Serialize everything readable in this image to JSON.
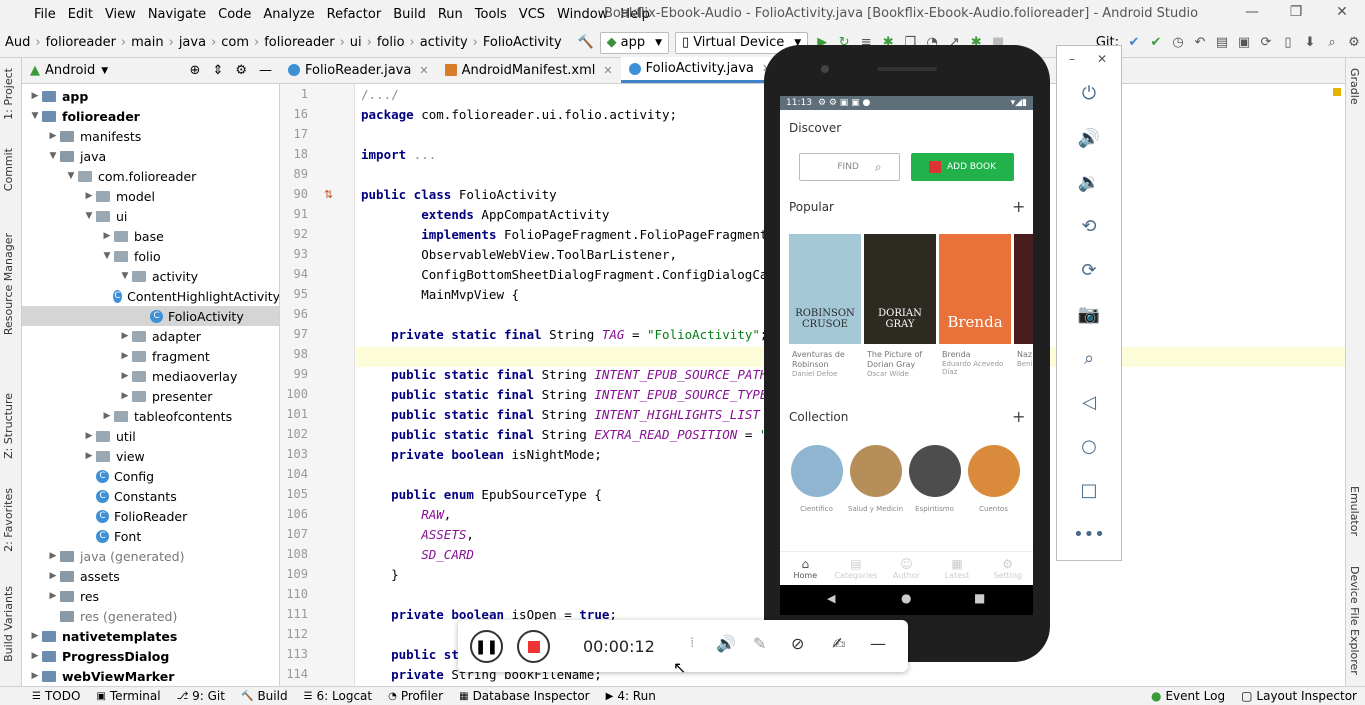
{
  "window": {
    "title": "Bookflix-Ebook-Audio - FolioActivity.java [Bookflix-Ebook-Audio.folioreader] - Android Studio",
    "menus": [
      "File",
      "Edit",
      "View",
      "Navigate",
      "Code",
      "Analyze",
      "Refactor",
      "Build",
      "Run",
      "Tools",
      "VCS",
      "Window",
      "Help"
    ]
  },
  "toolbar": {
    "breadcrumbs": [
      "Aud",
      "folioreader",
      "main",
      "java",
      "com",
      "folioreader",
      "ui",
      "folio",
      "activity",
      "FolioActivity"
    ],
    "run_config": "app",
    "device": "Virtual Device",
    "git_label": "Git:"
  },
  "left_strip": {
    "tabs": [
      "1: Project",
      "Commit",
      "Resource Manager",
      "Z: Structure",
      "2: Favorites",
      "Build Variants"
    ]
  },
  "right_strip": {
    "tabs": [
      "Gradle",
      "Emulator",
      "Device File Explorer"
    ]
  },
  "project": {
    "view_label": "Android",
    "tree": [
      {
        "label": "app",
        "depth": 0,
        "arrow": "▶",
        "icon": "mod",
        "bold": true
      },
      {
        "label": "folioreader",
        "depth": 0,
        "arrow": "▼",
        "icon": "mod",
        "bold": true
      },
      {
        "label": "manifests",
        "depth": 1,
        "arrow": "▶",
        "icon": "folder"
      },
      {
        "label": "java",
        "depth": 1,
        "arrow": "▼",
        "icon": "folder"
      },
      {
        "label": "com.folioreader",
        "depth": 2,
        "arrow": "▼",
        "icon": "pkg"
      },
      {
        "label": "model",
        "depth": 3,
        "arrow": "▶",
        "icon": "pkg"
      },
      {
        "label": "ui",
        "depth": 3,
        "arrow": "▼",
        "icon": "pkg"
      },
      {
        "label": "base",
        "depth": 4,
        "arrow": "▶",
        "icon": "pkg"
      },
      {
        "label": "folio",
        "depth": 4,
        "arrow": "▼",
        "icon": "pkg"
      },
      {
        "label": "activity",
        "depth": 5,
        "arrow": "▼",
        "icon": "pkg"
      },
      {
        "label": "ContentHighlightActivity",
        "depth": 6,
        "arrow": "",
        "icon": "cls"
      },
      {
        "label": "FolioActivity",
        "depth": 6,
        "arrow": "",
        "icon": "cls",
        "selected": true
      },
      {
        "label": "adapter",
        "depth": 5,
        "arrow": "▶",
        "icon": "pkg"
      },
      {
        "label": "fragment",
        "depth": 5,
        "arrow": "▶",
        "icon": "pkg"
      },
      {
        "label": "mediaoverlay",
        "depth": 5,
        "arrow": "▶",
        "icon": "pkg"
      },
      {
        "label": "presenter",
        "depth": 5,
        "arrow": "▶",
        "icon": "pkg"
      },
      {
        "label": "tableofcontents",
        "depth": 4,
        "arrow": "▶",
        "icon": "pkg"
      },
      {
        "label": "util",
        "depth": 3,
        "arrow": "▶",
        "icon": "pkg"
      },
      {
        "label": "view",
        "depth": 3,
        "arrow": "▶",
        "icon": "pkg"
      },
      {
        "label": "Config",
        "depth": 3,
        "arrow": "",
        "icon": "cls"
      },
      {
        "label": "Constants",
        "depth": 3,
        "arrow": "",
        "icon": "cls"
      },
      {
        "label": "FolioReader",
        "depth": 3,
        "arrow": "",
        "icon": "cls"
      },
      {
        "label": "Font",
        "depth": 3,
        "arrow": "",
        "icon": "cls"
      },
      {
        "label": "java (generated)",
        "depth": 1,
        "arrow": "▶",
        "icon": "folder"
      },
      {
        "label": "assets",
        "depth": 1,
        "arrow": "▶",
        "icon": "folder"
      },
      {
        "label": "res",
        "depth": 1,
        "arrow": "▶",
        "icon": "folder"
      },
      {
        "label": "res (generated)",
        "depth": 1,
        "arrow": "",
        "icon": "folder"
      },
      {
        "label": "nativetemplates",
        "depth": 0,
        "arrow": "▶",
        "icon": "mod",
        "bold": true
      },
      {
        "label": "ProgressDialog",
        "depth": 0,
        "arrow": "▶",
        "icon": "mod",
        "bold": true
      },
      {
        "label": "webViewMarker",
        "depth": 0,
        "arrow": "▶",
        "icon": "mod",
        "bold": true
      }
    ]
  },
  "editor": {
    "tabs": [
      {
        "label": "FolioReader.java",
        "active": false
      },
      {
        "label": "AndroidManifest.xml",
        "active": false
      },
      {
        "label": "FolioActivity.java",
        "active": true
      }
    ],
    "lines": [
      {
        "n": "1",
        "html": "<span class=\"cm\">/.../</span>"
      },
      {
        "n": "16",
        "html": "<span class=\"kw\">package</span> com.folioreader.ui.folio.activity;"
      },
      {
        "n": "17",
        "html": ""
      },
      {
        "n": "18",
        "html": "<span class=\"kw\">import</span> <span class=\"cm\">...</span>"
      },
      {
        "n": "89",
        "html": ""
      },
      {
        "n": "90",
        "html": "<span class=\"kw\">public class</span> FolioActivity"
      },
      {
        "n": "91",
        "html": "        <span class=\"kw\">extends</span> AppCompatActivity"
      },
      {
        "n": "92",
        "html": "        <span class=\"kw\">implements</span> FolioPageFragment.FolioPageFragmentCallback,"
      },
      {
        "n": "93",
        "html": "        ObservableWebView.ToolBarListener,"
      },
      {
        "n": "94",
        "html": "        ConfigBottomSheetDialogFragment.ConfigDialogCallback,"
      },
      {
        "n": "95",
        "html": "        MainMvpView {"
      },
      {
        "n": "96",
        "html": ""
      },
      {
        "n": "97",
        "html": "    <span class=\"kw\">private static final</span> String <span class=\"it\">TAG</span> = <span class=\"str\">\"FolioActivity\"</span>;"
      },
      {
        "n": "98",
        "html": "",
        "hl": true
      },
      {
        "n": "99",
        "html": "    <span class=\"kw\">public static final</span> String <span class=\"it\">INTENT_EPUB_SOURCE_PATH</span> = <span class=\"str\">\"</span>"
      },
      {
        "n": "100",
        "html": "    <span class=\"kw\">public static final</span> String <span class=\"it\">INTENT_EPUB_SOURCE_TYPE</span> = <span class=\"str\">\"</span>"
      },
      {
        "n": "101",
        "html": "    <span class=\"kw\">public static final</span> String <span class=\"it\">INTENT_HIGHLIGHTS_LIST</span> = <span class=\"str\">\"H</span>"
      },
      {
        "n": "102",
        "html": "    <span class=\"kw\">public static final</span> String <span class=\"it\">EXTRA_READ_POSITION</span> = <span class=\"str\">\"com</span>"
      },
      {
        "n": "103",
        "html": "    <span class=\"kw\">private boolean</span> isNightMode;"
      },
      {
        "n": "104",
        "html": ""
      },
      {
        "n": "105",
        "html": "    <span class=\"kw\">public enum</span> EpubSourceType {"
      },
      {
        "n": "106",
        "html": "        <span class=\"it\">RAW</span>,"
      },
      {
        "n": "107",
        "html": "        <span class=\"it\">ASSETS</span>,"
      },
      {
        "n": "108",
        "html": "        <span class=\"it\">SD_CARD</span>"
      },
      {
        "n": "109",
        "html": "    }"
      },
      {
        "n": "110",
        "html": ""
      },
      {
        "n": "111",
        "html": "    <span class=\"kw\">private boolean</span> isOpen = <span class=\"kw\">true</span>;"
      },
      {
        "n": "112",
        "html": ""
      },
      {
        "n": "113",
        "html": "    <span class=\"kw\">public sta</span>"
      },
      {
        "n": "114",
        "html": "    <span class=\"kw\">private</span> String bookFileName;"
      }
    ]
  },
  "statusbar": {
    "items": [
      "TODO",
      "Terminal",
      "9: Git",
      "Build",
      "6: Logcat",
      "Profiler",
      "Database Inspector",
      "4: Run"
    ],
    "right_items": [
      "Event Log",
      "Layout Inspector"
    ]
  },
  "phone": {
    "status_time": "11:13",
    "discover": "Discover",
    "find_placeholder": "FIND",
    "add_book": "ADD BOOK",
    "popular": "Popular",
    "collection": "Collection",
    "books": [
      {
        "title": "Aventuras de Robinson",
        "author": "Daniel Defoe",
        "cover_text": "ROBINSON CRUSOE",
        "color": "#a5c8d6"
      },
      {
        "title": "The Picture of Dorian Gray",
        "author": "Oscar Wilde",
        "cover_text": "DORIAN GRAY",
        "color": "#2d2a22"
      },
      {
        "title": "Brenda",
        "author": "Eduardo Acevedo Díaz",
        "cover_text": "Brenda",
        "color": "#e8723a"
      },
      {
        "title": "Naz",
        "author": "Beni Gald",
        "cover_text": "Na",
        "color": "#4a1e1e"
      }
    ],
    "collections": [
      {
        "label": "Científico",
        "color": "#8fb5d0"
      },
      {
        "label": "Salud y Medicina",
        "color": "#b58e5a"
      },
      {
        "label": "Espiritismo",
        "color": "#4d4d4d"
      },
      {
        "label": "Cuentos",
        "color": "#d98a3a"
      }
    ],
    "bottom_nav": [
      "Home",
      "Categories",
      "Author",
      "Latest",
      "Setting"
    ]
  },
  "recorder": {
    "time": "00:00:12"
  }
}
